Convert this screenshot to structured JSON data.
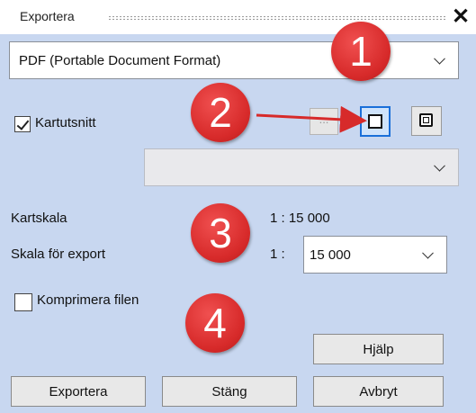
{
  "window": {
    "title": "Exportera"
  },
  "format": {
    "selected": "PDF (Portable Document Format)"
  },
  "map_extent": {
    "label": "Kartutsnitt",
    "checked": true,
    "frame_button_label": "...",
    "selected": ""
  },
  "scale": {
    "map_scale_label": "Kartskala",
    "map_scale_value": "1 : 15 000",
    "export_scale_label": "Skala för export",
    "export_prefix": "1 :",
    "export_value": "15 000"
  },
  "compress": {
    "label": "Komprimera filen",
    "checked": false
  },
  "buttons": {
    "help": "Hjälp",
    "export": "Exportera",
    "close": "Stäng",
    "cancel": "Avbryt"
  },
  "callouts": [
    "1",
    "2",
    "3",
    "4"
  ],
  "colors": {
    "accent": "#1a6fd9",
    "callout": "#d72a2a",
    "panel": "#c8d7f0"
  }
}
